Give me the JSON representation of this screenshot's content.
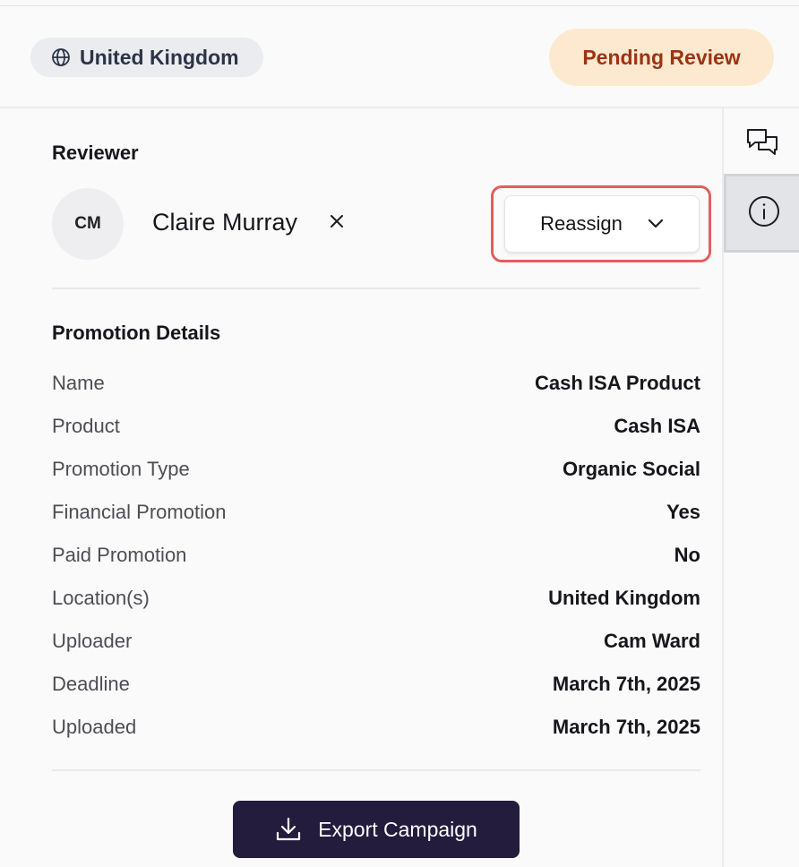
{
  "header": {
    "location_chip": {
      "label": "United Kingdom",
      "icon": "globe-icon"
    },
    "status": {
      "label": "Pending Review",
      "bg_color": "#fde9cf",
      "text_color": "#9a3412"
    }
  },
  "side_rail": {
    "items": [
      {
        "icon": "chat-bubbles-icon",
        "active": false
      },
      {
        "icon": "info-icon",
        "active": true
      }
    ]
  },
  "reviewer": {
    "section_title": "Reviewer",
    "initials": "CM",
    "name": "Claire Murray",
    "remove_icon": "close-icon",
    "reassign_label": "Reassign",
    "reassign_icon": "chevron-down-icon",
    "highlight_color": "#e35d60"
  },
  "promotion_details": {
    "section_title": "Promotion Details",
    "rows": [
      {
        "label": "Name",
        "value": "Cash ISA Product"
      },
      {
        "label": "Product",
        "value": "Cash ISA"
      },
      {
        "label": "Promotion Type",
        "value": "Organic Social"
      },
      {
        "label": "Financial Promotion",
        "value": "Yes"
      },
      {
        "label": "Paid Promotion",
        "value": "No"
      },
      {
        "label": "Location(s)",
        "value": "United Kingdom"
      },
      {
        "label": "Uploader",
        "value": "Cam Ward"
      },
      {
        "label": "Deadline",
        "value": "March 7th, 2025"
      },
      {
        "label": "Uploaded",
        "value": "March 7th, 2025"
      }
    ]
  },
  "export": {
    "label": "Export Campaign",
    "icon": "download-icon",
    "bg_color": "#231c3d"
  }
}
